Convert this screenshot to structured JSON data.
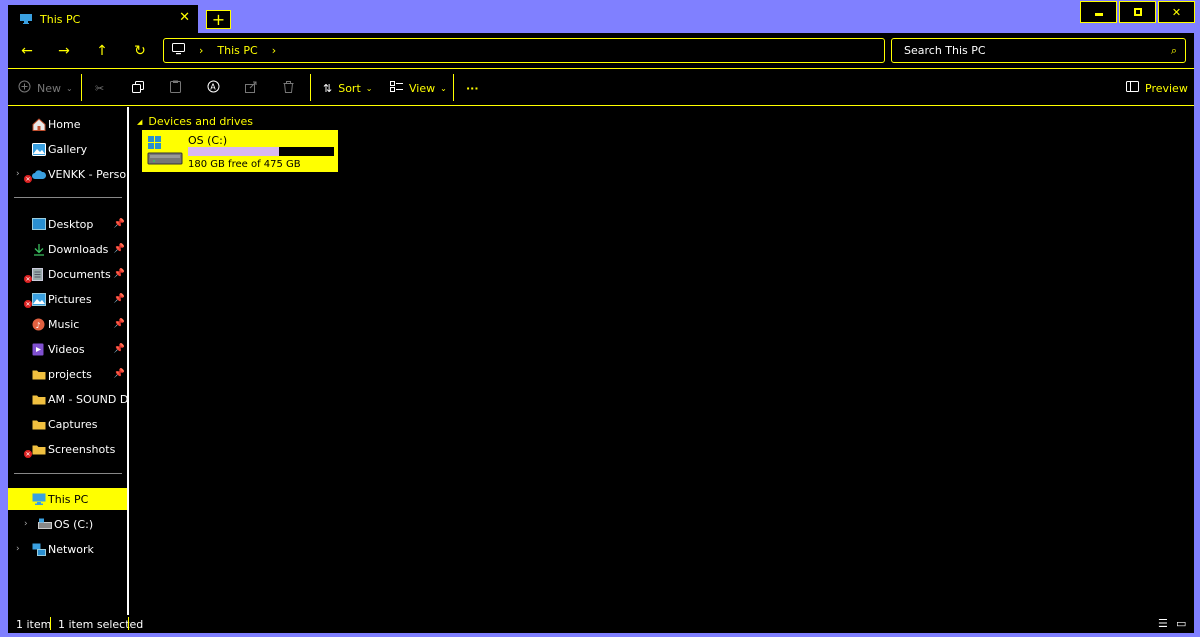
{
  "tab": {
    "title": "This PC",
    "close_label": "✕",
    "new_tab_label": "+"
  },
  "window_controls": {
    "minimize": "▬",
    "maximize": "▣",
    "close": "✕"
  },
  "address": {
    "crumbs": [
      "This PC"
    ],
    "search_placeholder": "Search This PC"
  },
  "command_bar": {
    "new_label": "New",
    "sort_label": "Sort",
    "view_label": "View",
    "more_label": "···",
    "preview_label": "Preview"
  },
  "sidebar": {
    "items": [
      {
        "label": "Home",
        "icon": "home-icon"
      },
      {
        "label": "Gallery",
        "icon": "gallery-icon"
      },
      {
        "label": "VENKK - Personal",
        "icon": "onedrive-icon"
      },
      {
        "label": "Desktop",
        "icon": "desktop-icon"
      },
      {
        "label": "Downloads",
        "icon": "downloads-icon"
      },
      {
        "label": "Documents",
        "icon": "documents-icon"
      },
      {
        "label": "Pictures",
        "icon": "pictures-icon"
      },
      {
        "label": "Music",
        "icon": "music-icon"
      },
      {
        "label": "Videos",
        "icon": "videos-icon"
      },
      {
        "label": "projects",
        "icon": "folder-icon"
      },
      {
        "label": "AM - SOUND DESIG",
        "icon": "folder-icon"
      },
      {
        "label": "Captures",
        "icon": "folder-icon"
      },
      {
        "label": "Screenshots",
        "icon": "folder-icon"
      },
      {
        "label": "This PC",
        "icon": "this-pc-icon"
      },
      {
        "label": "OS (C:)",
        "icon": "drive-icon"
      },
      {
        "label": "Network",
        "icon": "network-icon"
      }
    ]
  },
  "main": {
    "group_header": "Devices and drives",
    "drive": {
      "name": "OS (C:)",
      "free_text": "180 GB free of 475 GB",
      "used_fraction": 0.62
    }
  },
  "status": {
    "item_count": "1 item",
    "selected_count": "1 item selected"
  },
  "colors": {
    "accent": "#ffff00",
    "frame": "#8080ff",
    "background": "#000000",
    "usage_bar": "#d8b8f0"
  }
}
